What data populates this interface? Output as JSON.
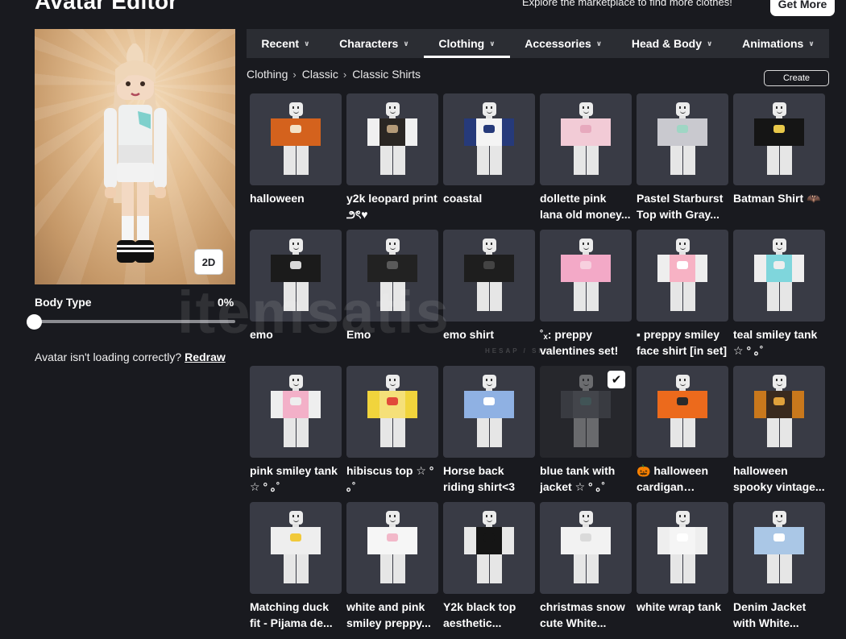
{
  "header": {
    "title": "Avatar Editor",
    "promo_text": "Explore the marketplace to find more clothes!",
    "get_more_label": "Get More"
  },
  "preview": {
    "toggle_2d_label": "2D"
  },
  "body_type": {
    "label": "Body Type",
    "value": "0%",
    "level_fraction": 0
  },
  "loading_help": {
    "text": "Avatar isn't loading correctly?",
    "link": "Redraw"
  },
  "tabs": [
    {
      "label": "Recent"
    },
    {
      "label": "Characters"
    },
    {
      "label": "Clothing",
      "active": true
    },
    {
      "label": "Accessories"
    },
    {
      "label": "Head & Body"
    },
    {
      "label": "Animations"
    }
  ],
  "breadcrumb": [
    "Clothing",
    "Classic",
    "Classic Shirts"
  ],
  "create_label": "Create",
  "items": [
    {
      "name": "halloween",
      "torso": "#d4621d",
      "arms": "#d4621d",
      "mark": "#f3e3c8"
    },
    {
      "name": "y2k leopard print ౨ৎ♥",
      "torso": "#2a2623",
      "arms": "#f0f0f0",
      "mark": "#b49a78"
    },
    {
      "name": "coastal",
      "torso": "#f4f4f4",
      "arms": "#263a7a",
      "mark": "#263a7a"
    },
    {
      "name": "dollette pink lana old money...",
      "torso": "#f2cbd6",
      "arms": "#f2cbd6",
      "mark": "#e7a9bd"
    },
    {
      "name": "Pastel Starburst Top with Gray...",
      "torso": "#c9c9cf",
      "arms": "#c9c9cf",
      "mark": "#9fd6c4"
    },
    {
      "name": "Batman Shirt 🦇",
      "torso": "#151515",
      "arms": "#151515",
      "mark": "#e8c84a"
    },
    {
      "name": "emo",
      "torso": "#1b1b1b",
      "arms": "#1b1b1b",
      "mark": "#d9d9d9"
    },
    {
      "name": "Emo",
      "torso": "#222222",
      "arms": "#222222",
      "mark": "#5a5a5a"
    },
    {
      "name": "emo shirt",
      "torso": "#1e1e1e",
      "arms": "#1e1e1e",
      "mark": "#444444"
    },
    {
      "name": "˚ₓ: preppy valentines set!",
      "torso": "#f3a9c7",
      "arms": "#f3a9c7",
      "mark": "#f7d0df"
    },
    {
      "name": "▪ preppy smiley face shirt [in set]",
      "torso": "#f7b2c4",
      "arms": "#eeeeee",
      "mark": "#ffffff"
    },
    {
      "name": "teal smiley tank ☆ ° ｡˚",
      "torso": "#7fd6dc",
      "arms": "#eeeeee",
      "mark": "#eeeeee"
    },
    {
      "name": "pink smiley tank ☆ ° ｡˚",
      "torso": "#f3b0c8",
      "arms": "#eeeeee",
      "mark": "#eeeeee"
    },
    {
      "name": "hibiscus top ☆ ° ｡˚",
      "torso": "#f5e079",
      "arms": "#f1d43c",
      "mark": "#e14a3a"
    },
    {
      "name": "Horse back riding shirt<3",
      "torso": "#8fb1e3",
      "arms": "#8fb1e3",
      "mark": "#ffffff"
    },
    {
      "name": "blue tank with jacket ☆ ° ｡˚",
      "torso": "#7a7d85",
      "arms": "#5e6068",
      "mark": "#74a7a5",
      "selected": true
    },
    {
      "name": "🎃 halloween cardigan spook...",
      "torso": "#ec6a1c",
      "arms": "#ec6a1c",
      "mark": "#2a2a2a"
    },
    {
      "name": "halloween spooky vintage...",
      "torso": "#3a2a1e",
      "arms": "#c9781c",
      "mark": "#e0a13b"
    },
    {
      "name": "Matching duck fit - Pijama de...",
      "torso": "#eeeeee",
      "arms": "#eeeeee",
      "mark": "#f1c93a"
    },
    {
      "name": "white and pink smiley preppy...",
      "torso": "#f6f6f6",
      "arms": "#f6f6f6",
      "mark": "#f2b8c9"
    },
    {
      "name": "Y2k black top aesthetic...",
      "torso": "#151515",
      "arms": "#e8e8e8",
      "mark": "#151515"
    },
    {
      "name": "christmas snow cute White...",
      "torso": "#f2f2f2",
      "arms": "#f2f2f2",
      "mark": "#dadada"
    },
    {
      "name": "white wrap tank",
      "torso": "#f5f5f5",
      "arms": "#eeeeee",
      "mark": "#ffffff"
    },
    {
      "name": "Denim Jacket with White...",
      "torso": "#aac7e6",
      "arms": "#aac7e6",
      "mark": "#ffffff"
    }
  ],
  "icons": {
    "chevron": "chevron-down-icon",
    "breadcrumb_separator": "chevron-right-icon",
    "selected": "checkmark-icon"
  },
  "watermark": {
    "text": "itemsatis",
    "sub": "HESAP / SKIN"
  }
}
